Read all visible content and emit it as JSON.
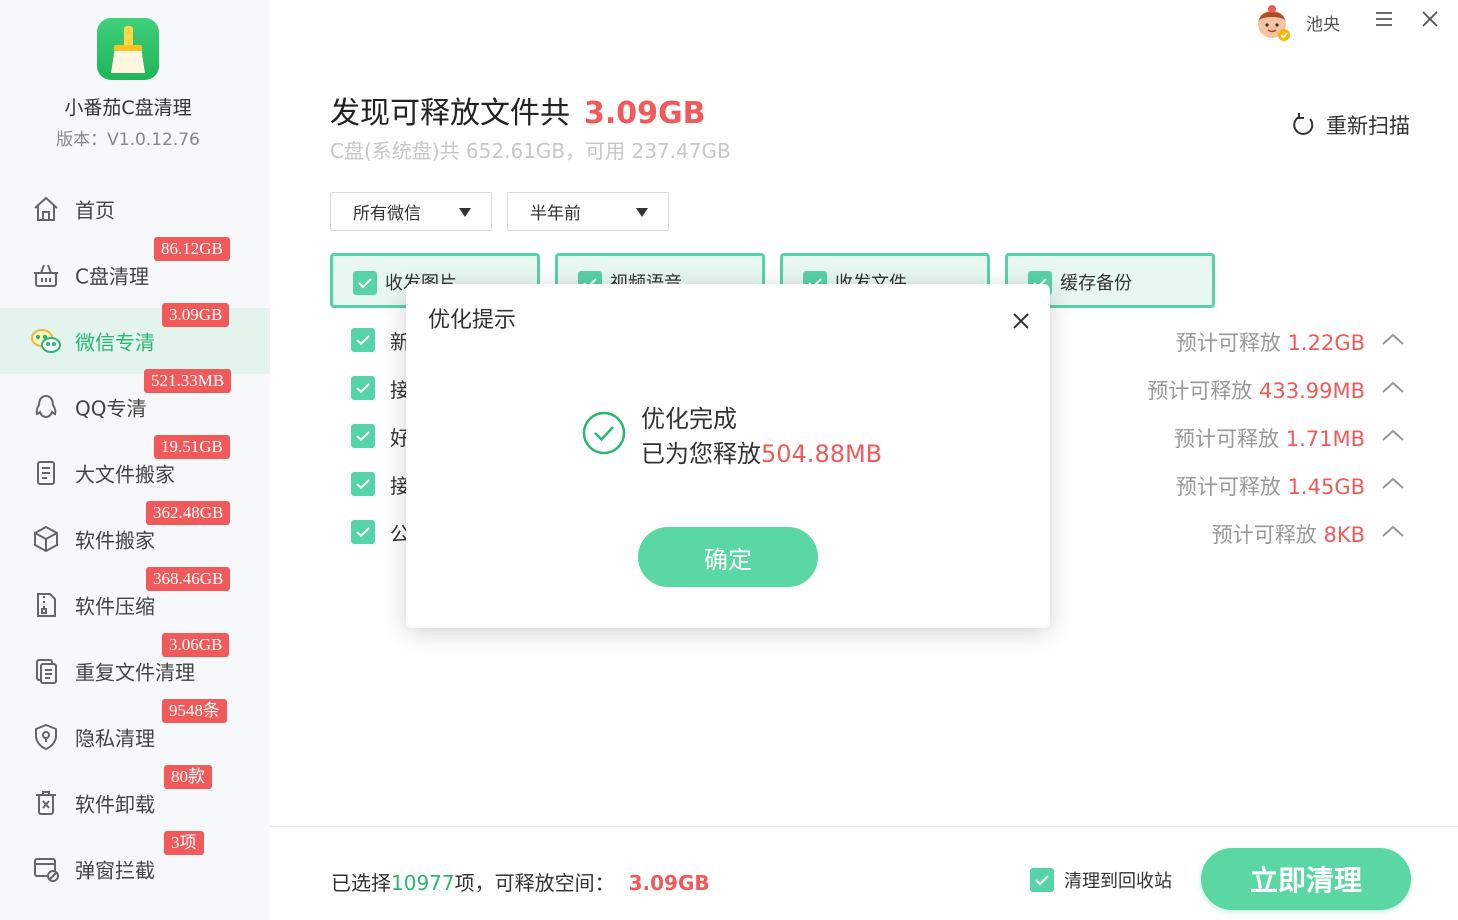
{
  "app": {
    "name": "小番茄C盘清理",
    "version": "版本：V1.0.12.76"
  },
  "topbar": {
    "username": "池央",
    "avatar_icon": "avatar-icon",
    "menu_icon": "menu-icon",
    "close_icon": "close-icon"
  },
  "sidebar": {
    "items": [
      {
        "label": "首页",
        "badge": "",
        "icon": "home-icon"
      },
      {
        "label": "C盘清理",
        "badge": "86.12GB",
        "icon": "basket-icon"
      },
      {
        "label": "微信专清",
        "badge": "3.09GB",
        "icon": "wechat-icon",
        "active": true
      },
      {
        "label": "QQ专清",
        "badge": "521.33MB",
        "icon": "qq-icon"
      },
      {
        "label": "大文件搬家",
        "badge": "19.51GB",
        "icon": "document-icon"
      },
      {
        "label": "软件搬家",
        "badge": "362.48GB",
        "icon": "box-icon"
      },
      {
        "label": "软件压缩",
        "badge": "368.46GB",
        "icon": "zip-icon"
      },
      {
        "label": "重复文件清理",
        "badge": "3.06GB",
        "icon": "duplicate-icon"
      },
      {
        "label": "隐私清理",
        "badge": "9548条",
        "icon": "privacy-icon"
      },
      {
        "label": "软件卸载",
        "badge": "80款",
        "icon": "uninstall-icon"
      },
      {
        "label": "弹窗拦截",
        "badge": "3项",
        "icon": "popup-icon"
      }
    ]
  },
  "main": {
    "title": "发现可释放文件共",
    "title_size": "3.09GB",
    "disk_info": "C盘(系统盘)共 652.61GB，可用 237.47GB",
    "rescan_label": "重新扫描",
    "filters": {
      "account": "所有微信",
      "time": "半年前"
    },
    "tabs": [
      {
        "label": "收发图片",
        "checked": true
      },
      {
        "label": "视频语音",
        "checked": true
      },
      {
        "label": "收发文件",
        "checked": true
      },
      {
        "label": "缓存备份",
        "checked": true
      }
    ],
    "rows": [
      {
        "label": "新",
        "prefix": "预计可释放",
        "value": "1.22GB",
        "checked": true
      },
      {
        "label": "接",
        "prefix": "预计可释放",
        "value": "433.99MB",
        "checked": true
      },
      {
        "label": "好",
        "prefix": "预计可释放",
        "value": "1.71MB",
        "checked": true
      },
      {
        "label": "接",
        "prefix": "预计可释放",
        "value": "1.45GB",
        "checked": true
      },
      {
        "label": "公",
        "prefix": "预计可释放",
        "value": "8KB",
        "checked": true
      }
    ]
  },
  "footer": {
    "selected_prefix": "已选择",
    "selected_count": "10977",
    "selected_suffix": "项，可释放空间：",
    "free_size": "3.09GB",
    "recycle_label": "清理到回收站",
    "recycle_checked": true,
    "clean_button": "立即清理"
  },
  "dialog": {
    "title": "优化提示",
    "line1": "优化完成",
    "line2_prefix": "已为您释放",
    "line2_value": "504.88MB",
    "ok_button": "确定"
  },
  "colors": {
    "accent": "#57d3a8",
    "danger": "#f15a5a",
    "active_text": "#2bb673"
  }
}
